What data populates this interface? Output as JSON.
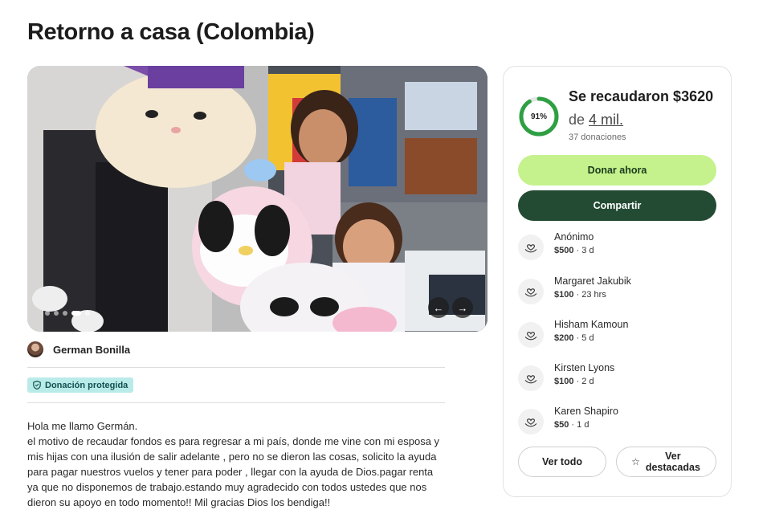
{
  "page": {
    "title": "Retorno a casa (Colombia)"
  },
  "gallery": {
    "dot_count": 5,
    "active_dot": 3,
    "prev_icon": "arrow-left-icon",
    "next_icon": "arrow-right-icon"
  },
  "organizer": {
    "name": "German Bonilla"
  },
  "badge": {
    "label": "Donación protegida",
    "icon": "shield-icon",
    "color": "#b9ebe9"
  },
  "story": {
    "lines": [
      "Hola me llamo Germán.",
      "el motivo de recaudar fondos es para regresar a mi país, donde me vine con mi esposa y mis hijas con una ilusión de salir adelante , pero no se dieron las cosas, solicito la ayuda para pagar nuestros vuelos y tener para poder , llegar con la ayuda de Dios.pagar renta ya que no disponemos de trabajo.estando muy agradecido con todos ustedes que nos dieron su apoyo en todo momento!! Mil gracias Dios los bendiga!!"
    ]
  },
  "progress": {
    "percent_label": "91%",
    "percent": 91,
    "raised_label": "Se recaudaron $3620",
    "goal_prefix": "de",
    "goal_amount": "4 mil.",
    "donations_count": "37 donaciones",
    "ring_color": "#2ea043"
  },
  "actions": {
    "donate_label": "Donar ahora",
    "share_label": "Compartir",
    "donate_color": "#c5f28c",
    "share_color": "#234b33"
  },
  "donors": [
    {
      "name": "Anónimo",
      "amount": "$500",
      "time": "3 d"
    },
    {
      "name": "Margaret Jakubik",
      "amount": "$100",
      "time": "23 hrs"
    },
    {
      "name": "Hisham Kamoun",
      "amount": "$200",
      "time": "5 d"
    },
    {
      "name": "Kirsten Lyons",
      "amount": "$100",
      "time": "2 d"
    },
    {
      "name": "Karen Shapiro",
      "amount": "$50",
      "time": "1 d"
    }
  ],
  "donor_icon": "heart-hand-icon",
  "footer_buttons": {
    "see_all": "Ver todo",
    "see_top": "Ver destacadas",
    "see_top_icon": "star-icon"
  }
}
